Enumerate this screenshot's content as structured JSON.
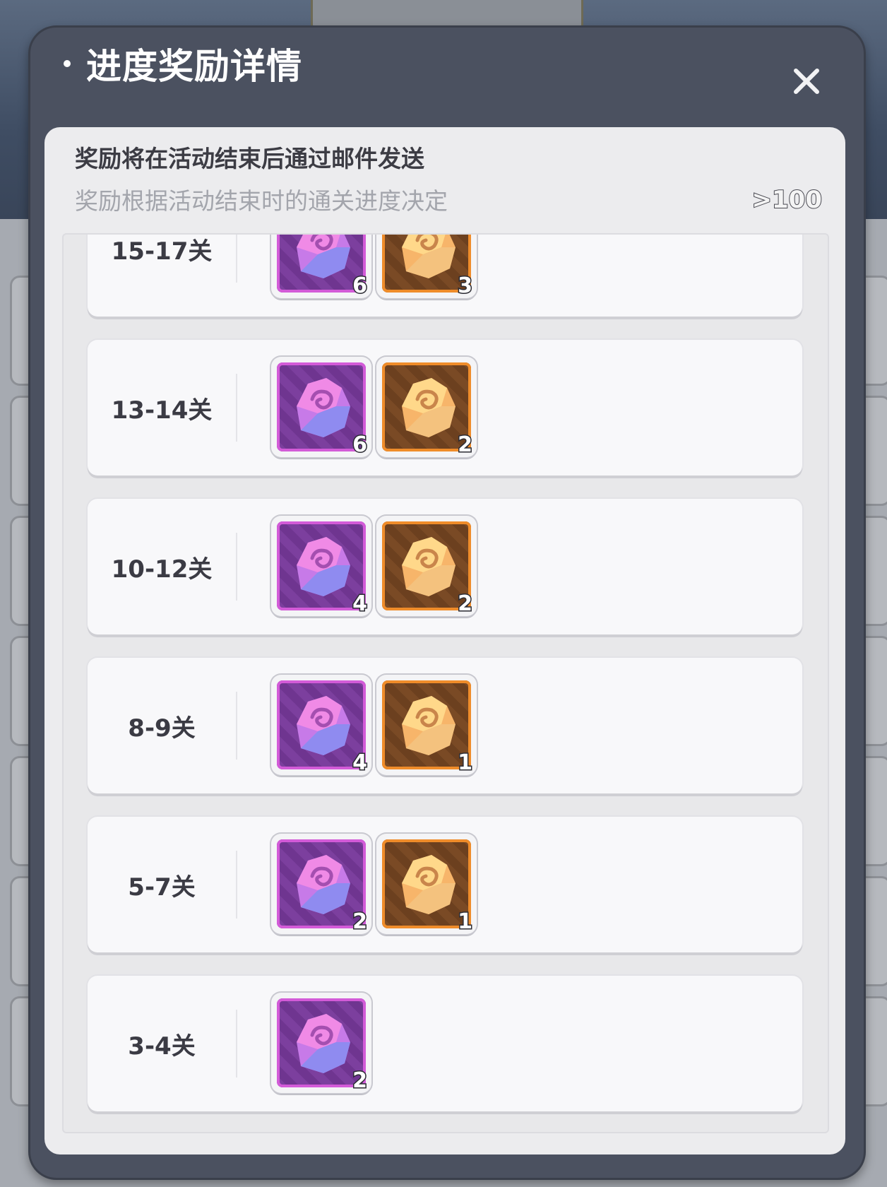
{
  "dialog": {
    "title": "进度奖励详情",
    "close_icon": "close-icon"
  },
  "notice": {
    "main": "奖励将在活动结束后通过邮件发送",
    "sub": "奖励根据活动结束时的通关进度决定",
    "progress": ">100"
  },
  "colors": {
    "dialog_bg": "#4b5160",
    "panel_bg": "#ececee",
    "purple_crystal": "#d66ee6",
    "orange_crystal": "#f7bd6e"
  },
  "tiers": [
    {
      "label": "15-17关",
      "rewards": [
        {
          "kind": "purple",
          "icon": "purple-crystal-icon",
          "count": "6"
        },
        {
          "kind": "orange",
          "icon": "orange-crystal-icon",
          "count": "3"
        }
      ]
    },
    {
      "label": "13-14关",
      "rewards": [
        {
          "kind": "purple",
          "icon": "purple-crystal-icon",
          "count": "6"
        },
        {
          "kind": "orange",
          "icon": "orange-crystal-icon",
          "count": "2"
        }
      ]
    },
    {
      "label": "10-12关",
      "rewards": [
        {
          "kind": "purple",
          "icon": "purple-crystal-icon",
          "count": "4"
        },
        {
          "kind": "orange",
          "icon": "orange-crystal-icon",
          "count": "2"
        }
      ]
    },
    {
      "label": "8-9关",
      "rewards": [
        {
          "kind": "purple",
          "icon": "purple-crystal-icon",
          "count": "4"
        },
        {
          "kind": "orange",
          "icon": "orange-crystal-icon",
          "count": "1"
        }
      ]
    },
    {
      "label": "5-7关",
      "rewards": [
        {
          "kind": "purple",
          "icon": "purple-crystal-icon",
          "count": "2"
        },
        {
          "kind": "orange",
          "icon": "orange-crystal-icon",
          "count": "1"
        }
      ]
    },
    {
      "label": "3-4关",
      "rewards": [
        {
          "kind": "purple",
          "icon": "purple-crystal-icon",
          "count": "2"
        }
      ]
    }
  ]
}
